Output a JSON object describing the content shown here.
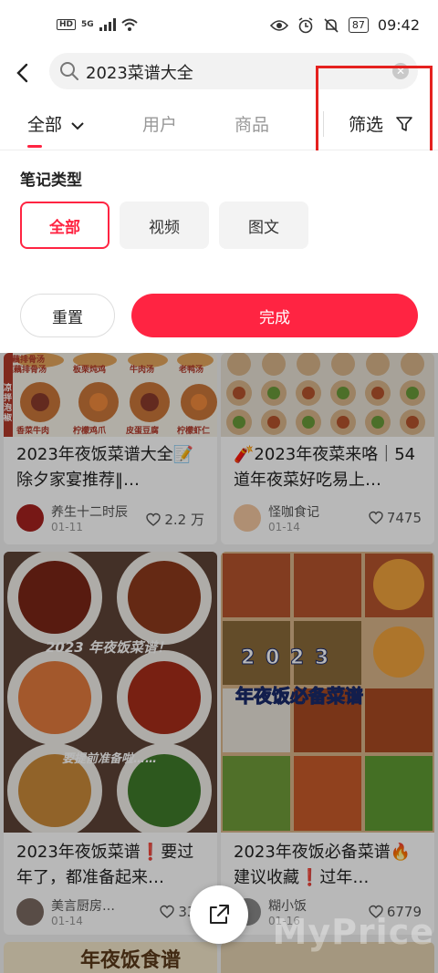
{
  "status_bar": {
    "network_badge": "HD",
    "network_type": "5G",
    "battery": "87",
    "time": "09:42"
  },
  "search": {
    "query": "2023菜谱大全"
  },
  "tabs": [
    {
      "label": "全部"
    },
    {
      "label": "用户"
    },
    {
      "label": "商品"
    }
  ],
  "filter": {
    "label": "筛选"
  },
  "panel": {
    "title": "笔记类型",
    "chips": [
      {
        "label": "全部"
      },
      {
        "label": "视频"
      },
      {
        "label": "图文"
      }
    ],
    "reset_label": "重置",
    "done_label": "完成"
  },
  "feed": {
    "cards": [
      {
        "title": "2023年夜饭菜谱大全📝除夕家宴推荐‖…",
        "author": "养生十二时辰",
        "date": "01-11",
        "likes": "2.2 万"
      },
      {
        "title": "🧨2023年夜菜来咯｜54道年夜菜好吃易上…",
        "author": "怪咖食记",
        "date": "01-14",
        "likes": "7475"
      },
      {
        "title": "2023年夜饭菜谱❗️要过年了，都准备起来…",
        "author": "美言厨房…",
        "date": "01-14",
        "likes": "336"
      },
      {
        "title": "2023年夜饭必备菜谱🔥建议收藏❗️过年…",
        "author": "糊小饭",
        "date": "01-16",
        "likes": "6779"
      }
    ],
    "image_texts": {
      "card1": [
        "莲藕排骨汤",
        "板栗炖鸡",
        "牛肉汤",
        "老鸭汤",
        "凉拌泡椒",
        "香菜牛肉",
        "柠檬鸡爪",
        "皮蛋豆腐",
        "柠檬虾仁"
      ],
      "card3": [
        "2023 年夜饭菜谱！",
        "要提前准备啦……"
      ],
      "card4": [
        "2 0 2 3",
        "年夜饭必备菜谱"
      ],
      "card5": "年夜饭食谱"
    }
  },
  "watermark": "MyPrice"
}
